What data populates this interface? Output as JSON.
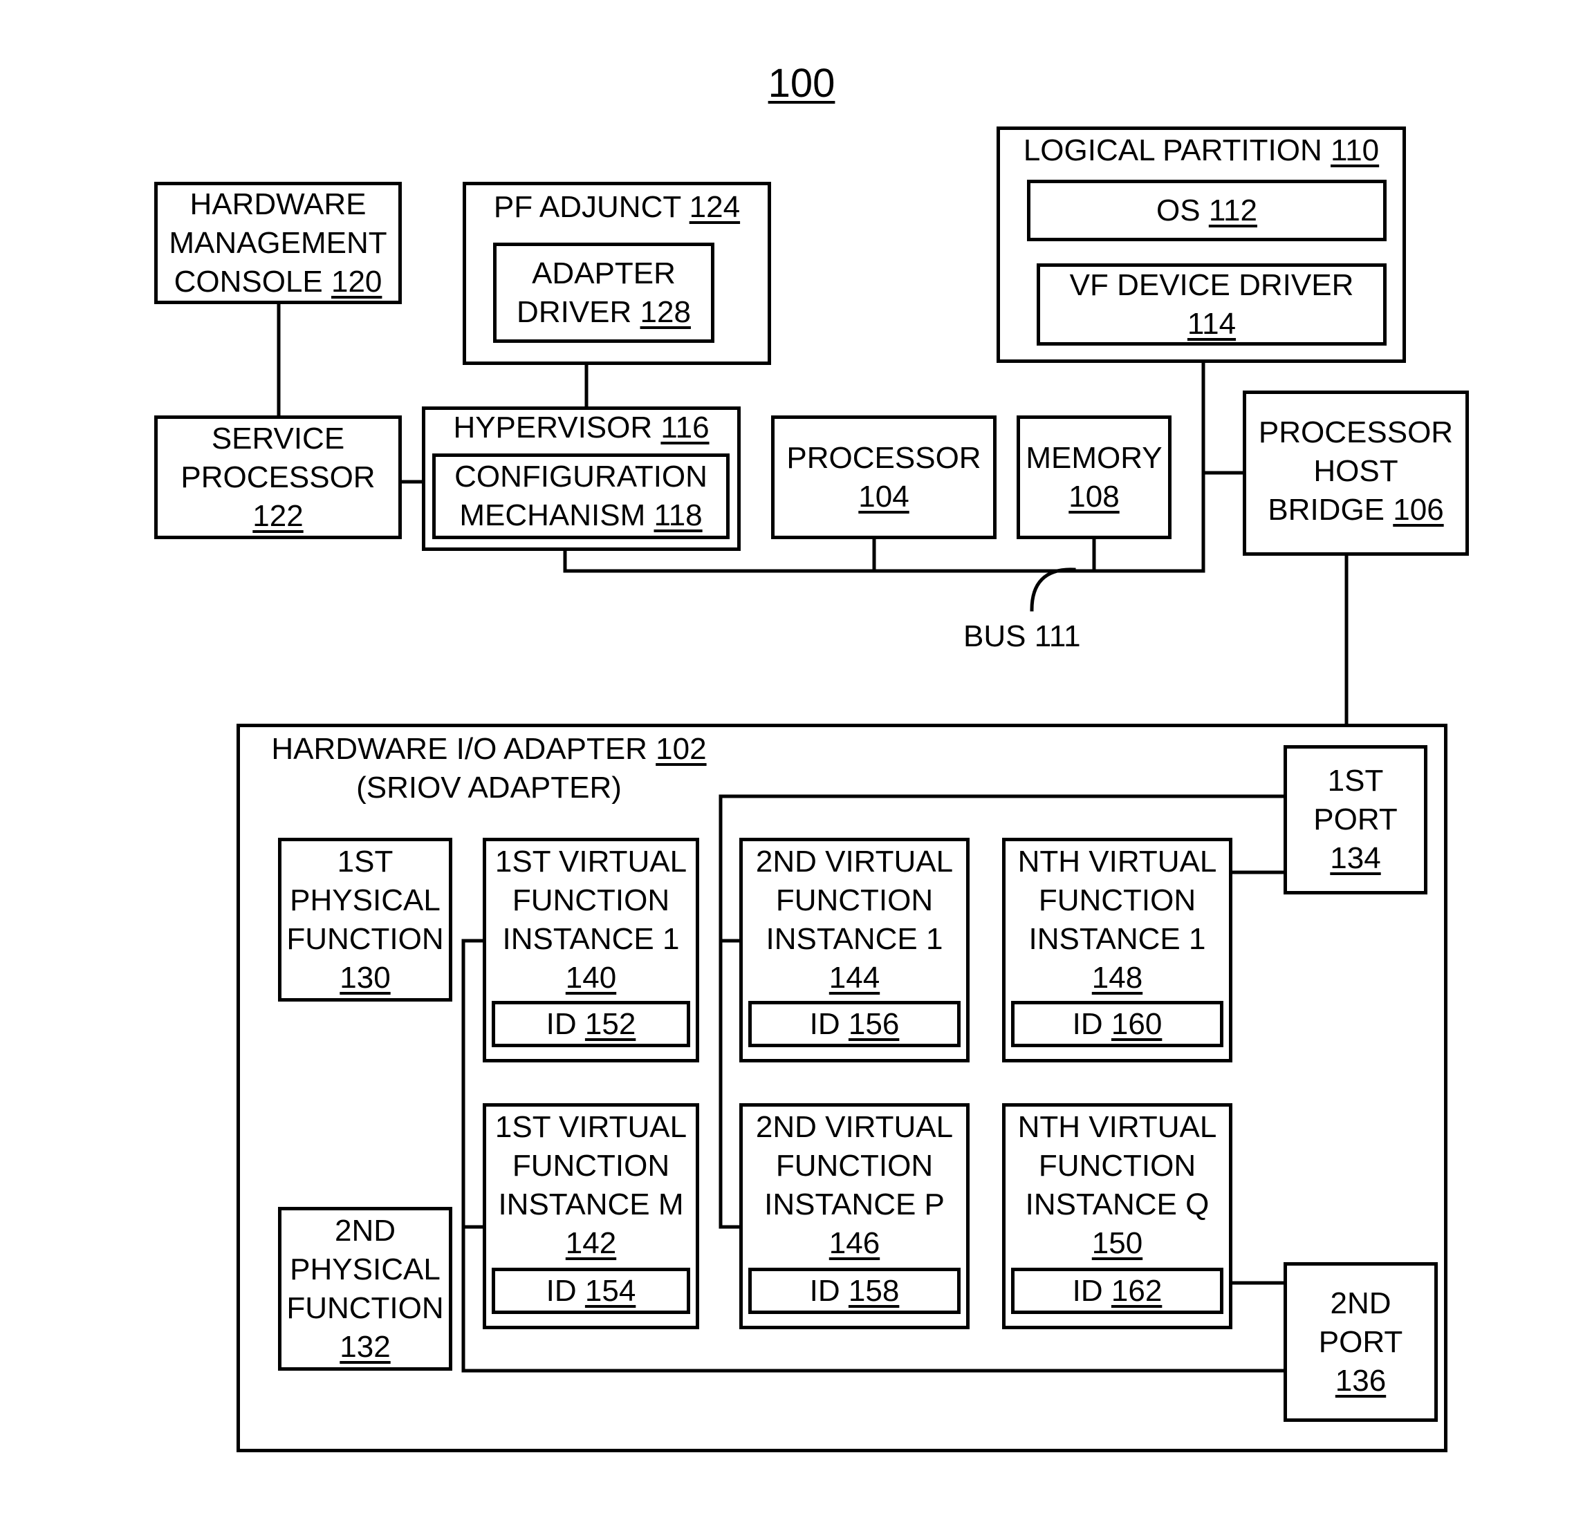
{
  "figure": {
    "number": "100"
  },
  "bus": {
    "label": "BUS 111"
  },
  "boxes": {
    "hmc": {
      "lines": [
        "HARDWARE",
        "MANAGEMENT"
      ],
      "last": "CONSOLE ",
      "ref": "120"
    },
    "pf_adjunct": {
      "title": "PF ADJUNCT ",
      "ref": "124"
    },
    "adapter_driver": {
      "lines": [
        "ADAPTER"
      ],
      "last": "DRIVER ",
      "ref": "128"
    },
    "lpar": {
      "title": "LOGICAL PARTITION ",
      "ref": "110"
    },
    "os": {
      "last": "OS ",
      "ref": "112"
    },
    "vf_driver": {
      "lines": [
        "VF DEVICE DRIVER"
      ],
      "last": "",
      "ref": "114"
    },
    "service_processor": {
      "lines": [
        "SERVICE",
        "PROCESSOR"
      ],
      "last": "",
      "ref": "122"
    },
    "hypervisor": {
      "title": "HYPERVISOR ",
      "ref": "116"
    },
    "config_mech": {
      "lines": [
        "CONFIGURATION"
      ],
      "last": "MECHANISM ",
      "ref": "118"
    },
    "processor": {
      "lines": [
        "PROCESSOR"
      ],
      "last": "",
      "ref": "104"
    },
    "memory": {
      "lines": [
        "MEMORY"
      ],
      "last": "",
      "ref": "108"
    },
    "phb": {
      "lines": [
        "PROCESSOR",
        "HOST"
      ],
      "last": "BRIDGE ",
      "ref": "106"
    },
    "adapter": {
      "title": "HARDWARE I/O ADAPTER ",
      "ref": "102",
      "subtitle": "(SRIOV ADAPTER)"
    },
    "pf1": {
      "lines": [
        "1ST",
        "PHYSICAL",
        "FUNCTION"
      ],
      "last": "",
      "ref": "130"
    },
    "pf2": {
      "lines": [
        "2ND",
        "PHYSICAL",
        "FUNCTION"
      ],
      "last": "",
      "ref": "132"
    },
    "vf140": {
      "lines": [
        "1ST VIRTUAL",
        "FUNCTION",
        "INSTANCE 1"
      ],
      "ref": "140",
      "id_label": "ID ",
      "id_ref": "152"
    },
    "vf142": {
      "lines": [
        "1ST VIRTUAL",
        "FUNCTION",
        "INSTANCE M"
      ],
      "ref": "142",
      "id_label": "ID ",
      "id_ref": "154"
    },
    "vf144": {
      "lines": [
        "2ND VIRTUAL",
        "FUNCTION",
        "INSTANCE 1"
      ],
      "ref": "144",
      "id_label": "ID ",
      "id_ref": "156"
    },
    "vf146": {
      "lines": [
        "2ND VIRTUAL",
        "FUNCTION",
        "INSTANCE P"
      ],
      "ref": "146",
      "id_label": "ID ",
      "id_ref": "158"
    },
    "vf148": {
      "lines": [
        "NTH VIRTUAL",
        "FUNCTION",
        "INSTANCE 1"
      ],
      "ref": "148",
      "id_label": "ID ",
      "id_ref": "160"
    },
    "vf150": {
      "lines": [
        "NTH VIRTUAL",
        "FUNCTION",
        "INSTANCE Q"
      ],
      "ref": "150",
      "id_label": "ID ",
      "id_ref": "162"
    },
    "port1": {
      "lines": [
        "1ST",
        "PORT"
      ],
      "last": "",
      "ref": "134"
    },
    "port2": {
      "lines": [
        "2ND",
        "PORT"
      ],
      "last": "",
      "ref": "136"
    }
  }
}
